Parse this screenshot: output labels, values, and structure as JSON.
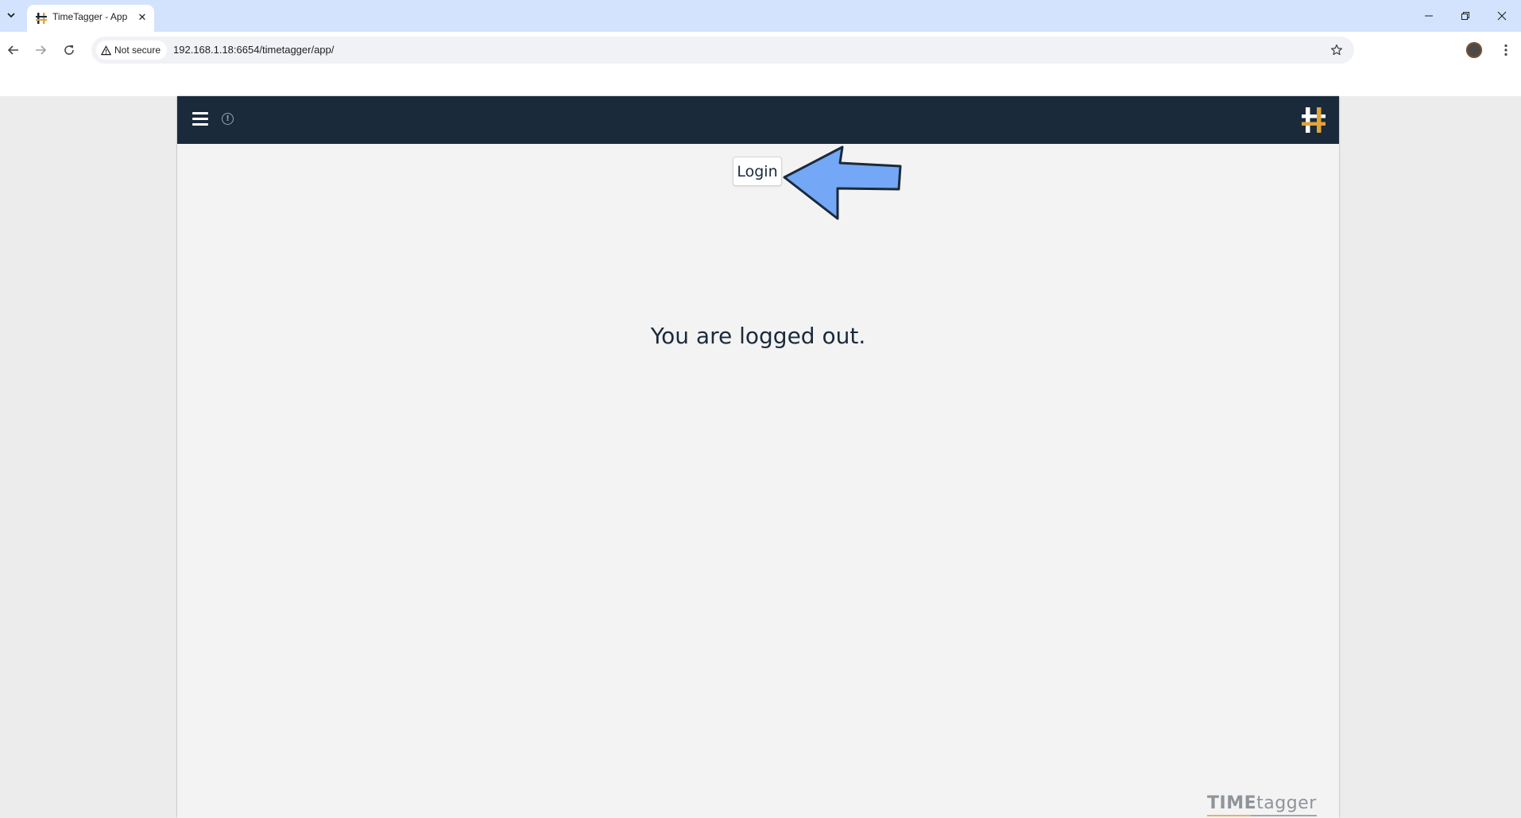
{
  "browser": {
    "tab": {
      "title": "TimeTagger - App",
      "close_glyph": "✕",
      "favicon": "timetagger-logo-icon"
    },
    "address_bar": {
      "security_label": "Not secure",
      "url": "192.168.1.18:6654/timetagger/app/"
    },
    "icons": {
      "tab_list": "chevron-down-icon",
      "back": "back-arrow-icon",
      "forward": "forward-arrow-icon",
      "reload": "reload-icon",
      "bookmark": "star-icon",
      "profile": "avatar",
      "menu": "kebab-menu-icon",
      "minimize": "minimize-icon",
      "restore": "restore-icon",
      "close": "close-icon"
    }
  },
  "app": {
    "header": {
      "menu_icon": "hamburger-icon",
      "alert_icon": "exclamation-icon",
      "alert_glyph": "!",
      "logo": "timetagger-logo-icon"
    },
    "main": {
      "login_label": "Login",
      "message": "You are logged out."
    },
    "footer": {
      "brand_time": "TIME",
      "brand_tagger": "tagger"
    }
  },
  "annotation": {
    "arrow_icon": "left-arrow-icon",
    "color": "#74a7f5"
  },
  "colors": {
    "header_bg": "#1b2a3b",
    "page_bg": "#f3f3f3",
    "tabstrip_bg": "#d3e3fd",
    "logo_accent": "#e0a43b"
  }
}
